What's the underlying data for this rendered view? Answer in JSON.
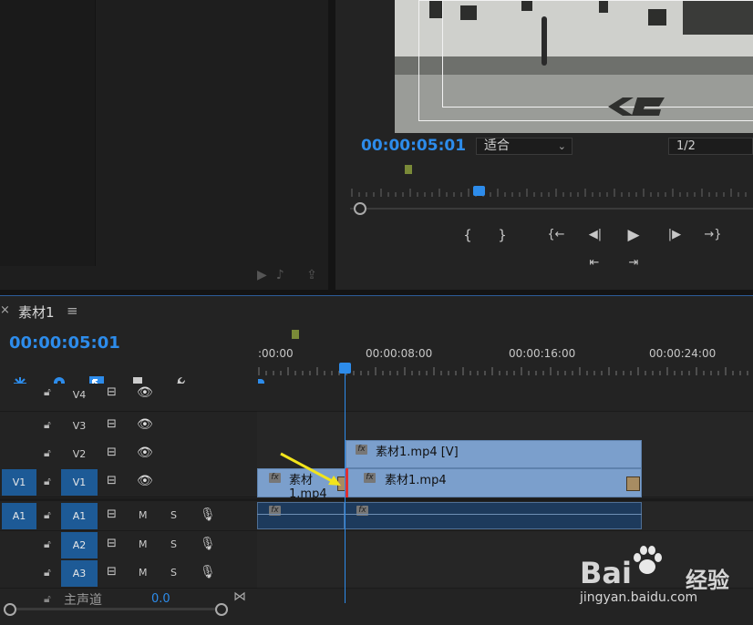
{
  "program": {
    "timecode": "00:00:05:01",
    "fit_label": "适合",
    "resolution": "1/2",
    "transport": [
      "{",
      "}",
      "{←",
      "◀|",
      "▶",
      "|▶",
      "→}",
      "⇤",
      "⇥"
    ]
  },
  "timeline": {
    "close": "×",
    "sequence_name": "素材1",
    "menu": "≡",
    "timecode": "00:00:05:01",
    "ruler_labels": [
      ":00:00",
      "00:00:08:00",
      "00:00:16:00",
      "00:00:24:00"
    ]
  },
  "tracks": {
    "v4": {
      "name": "V4"
    },
    "v3": {
      "name": "V3"
    },
    "v2": {
      "name": "V2"
    },
    "v1": {
      "source": "V1",
      "name": "V1"
    },
    "a1": {
      "source": "A1",
      "name": "A1",
      "m": "M",
      "s": "S"
    },
    "a2": {
      "name": "A2",
      "m": "M",
      "s": "S"
    },
    "a3": {
      "name": "A3",
      "m": "M",
      "s": "S"
    },
    "master": {
      "label": "主声道",
      "value": "0.0"
    }
  },
  "clips": {
    "v2_label": "素材1.mp4 [V]",
    "v1a_label": "素材1.mp4",
    "v1b_label": "素材1.mp4",
    "fx": "fx"
  },
  "watermark": {
    "brand": "Bai",
    "brand_cn": "经验",
    "url": "jingyan.baidu.com"
  },
  "colors": {
    "accent": "#2d8ceb",
    "clip_video": "#7b9fcc",
    "clip_audio": "#1d3a5c",
    "work_area": "#e8dc2a"
  }
}
